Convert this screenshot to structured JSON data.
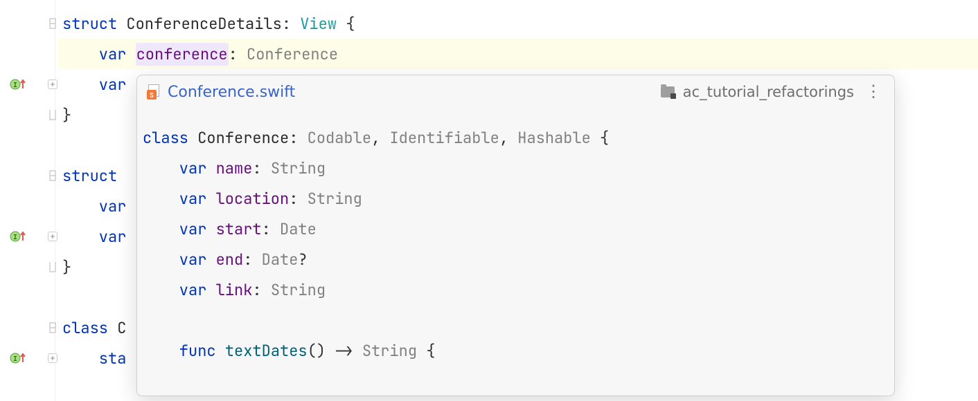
{
  "editor": {
    "lines": {
      "l0": {
        "kw": "struct",
        "name": "ConferenceDetails",
        "colon": ": ",
        "proto": "View",
        "brace": " {"
      },
      "l1": {
        "kw": "    var ",
        "name": "conference",
        "colon": ": ",
        "type": "Conference"
      },
      "l2": {
        "prefix": "    var"
      },
      "l3": {
        "text": "}"
      },
      "l4": {
        "kw": "struct "
      },
      "l5": {
        "kw": "    var"
      },
      "l6": {
        "kw": "    var"
      },
      "l7": {
        "text": "}"
      },
      "l8": {
        "kw": "class ",
        "rest": "C"
      },
      "l9": {
        "prefix": "    sta"
      }
    }
  },
  "popup": {
    "filename": "Conference.swift",
    "project": "ac_tutorial_refactorings",
    "file_icon_badge": "S",
    "code": {
      "l0": {
        "kw": "class ",
        "name": "Conference",
        "sep1": ": ",
        "proto1": "Codable",
        "sep2": ", ",
        "proto2": "Identifiable",
        "sep3": ", ",
        "proto3": "Hashable",
        "brace": " {"
      },
      "l1": {
        "kw": "    var ",
        "name": "name",
        "sep": ": ",
        "type": "String"
      },
      "l2": {
        "kw": "    var ",
        "name": "location",
        "sep": ": ",
        "type": "String"
      },
      "l3": {
        "kw": "    var ",
        "name": "start",
        "sep": ": ",
        "type": "Date"
      },
      "l4": {
        "kw": "    var ",
        "name": "end",
        "sep": ": ",
        "type": "Date",
        "opt": "?"
      },
      "l5": {
        "kw": "    var ",
        "name": "link",
        "sep": ": ",
        "type": "String"
      },
      "l6": {
        "text": ""
      },
      "l7": {
        "kw": "    func ",
        "name": "textDates",
        "sig": "() -> ",
        "type": "String",
        "brace": " {"
      }
    }
  }
}
